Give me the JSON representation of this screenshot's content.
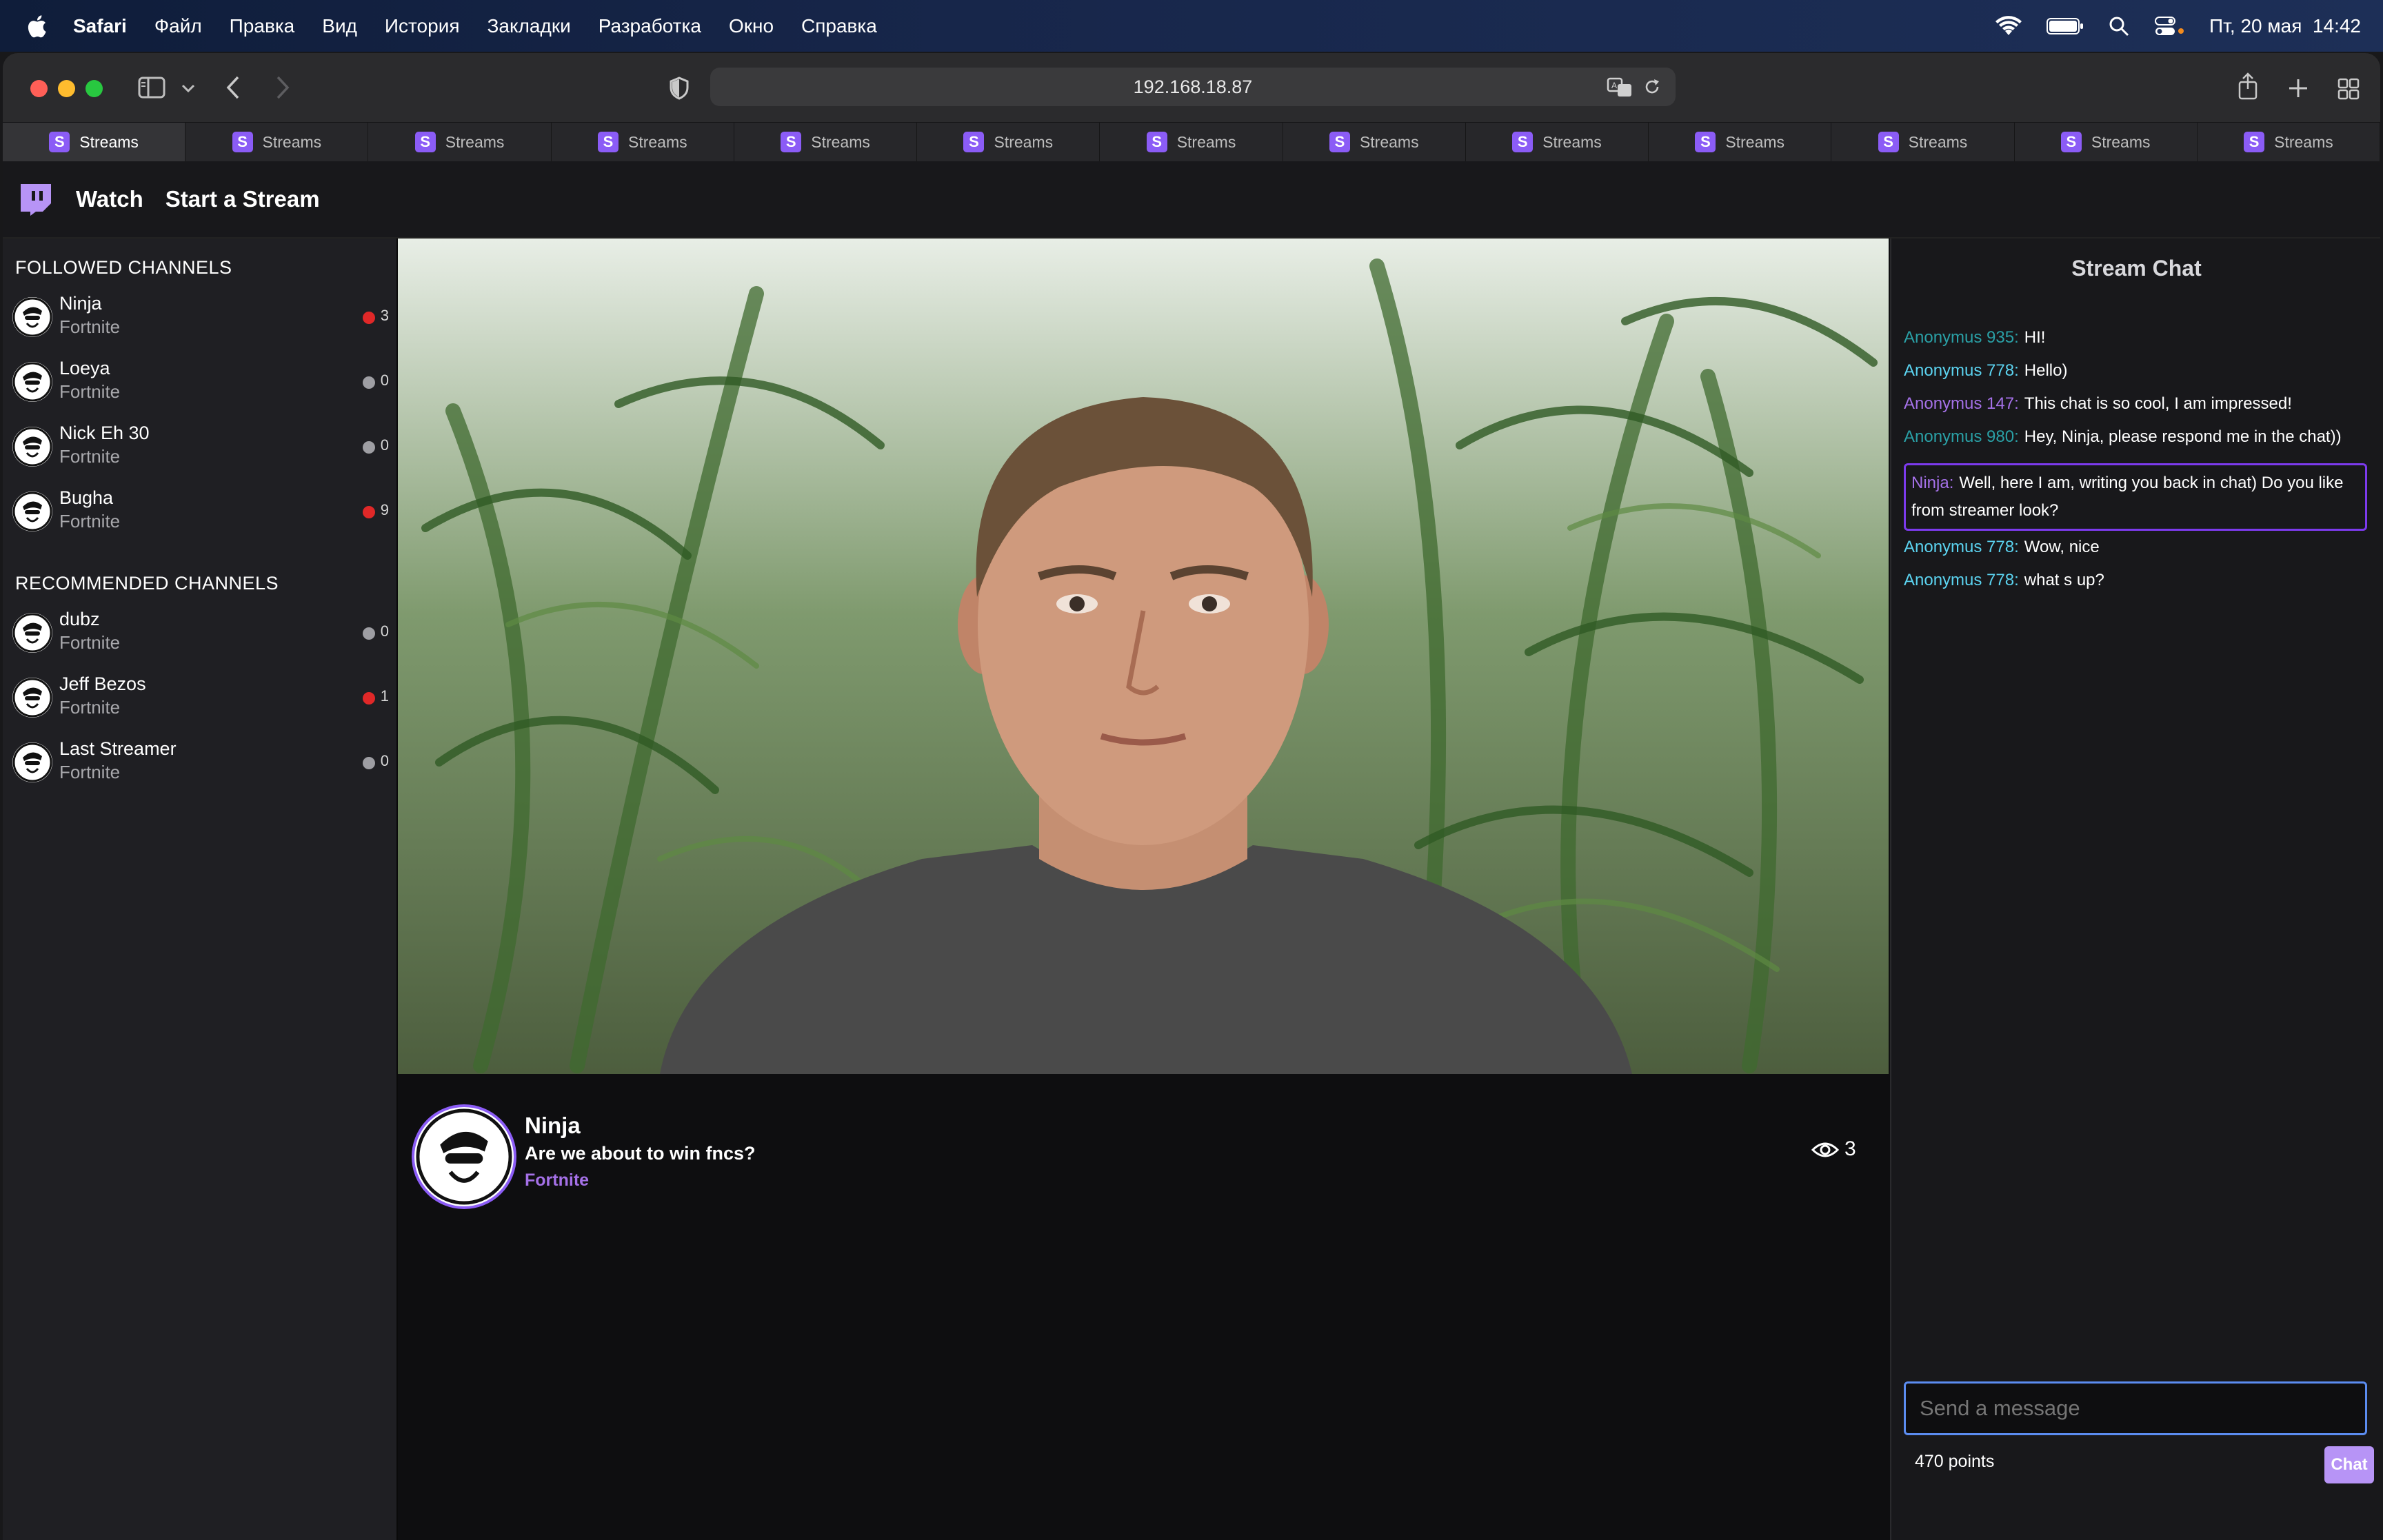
{
  "menubar": {
    "app": "Safari",
    "items": [
      "Файл",
      "Правка",
      "Вид",
      "История",
      "Закладки",
      "Разработка",
      "Окно",
      "Справка"
    ],
    "datetime": "Пт, 20 мая  14:42"
  },
  "browser": {
    "url": "192.168.18.87",
    "tabs": [
      "Streams",
      "Streams",
      "Streams",
      "Streams",
      "Streams",
      "Streams",
      "Streams",
      "Streams",
      "Streams",
      "Streams",
      "Streams",
      "Streams",
      "Streams"
    ],
    "favicon_letter": "S"
  },
  "nav": {
    "watch": "Watch",
    "start": "Start a Stream"
  },
  "sidebar": {
    "followed_title": "FOLLOWED CHANNELS",
    "followed": [
      {
        "name": "Ninja",
        "game": "Fortnite",
        "count": "3",
        "live": true
      },
      {
        "name": "Loeya",
        "game": "Fortnite",
        "count": "0",
        "live": false
      },
      {
        "name": "Nick Eh 30",
        "game": "Fortnite",
        "count": "0",
        "live": false
      },
      {
        "name": "Bugha",
        "game": "Fortnite",
        "count": "9",
        "live": true
      }
    ],
    "recommended_title": "RECOMMENDED CHANNELS",
    "recommended": [
      {
        "name": "dubz",
        "game": "Fortnite",
        "count": "0",
        "live": false
      },
      {
        "name": "Jeff Bezos",
        "game": "Fortnite",
        "count": "1",
        "live": true
      },
      {
        "name": "Last Streamer",
        "game": "Fortnite",
        "count": "0",
        "live": false
      }
    ]
  },
  "stream": {
    "streamer": "Ninja",
    "title": "Are we about to win fncs?",
    "game": "Fortnite",
    "viewers": "3"
  },
  "chat": {
    "title": "Stream Chat",
    "messages": [
      {
        "user": "Anonymus 935:",
        "text": "HI!",
        "color": "#2aa0a6"
      },
      {
        "user": "Anonymus 778:",
        "text": "Hello)",
        "color": "#5bd3f0"
      },
      {
        "user": "Anonymus 147:",
        "text": "This chat is so cool, I am impressed!",
        "color": "#a571e8"
      },
      {
        "user": "Anonymus 980:",
        "text": "Hey, Ninja, please respond me in the chat))",
        "color": "#2aa0a6"
      },
      {
        "user": "Ninja:",
        "text": "Well, here I am, writing you back in chat) Do you like from streamer look?",
        "color": "#a571e8",
        "highlight": true
      },
      {
        "user": "Anonymus 778:",
        "text": "Wow, nice",
        "color": "#5bd3f0"
      },
      {
        "user": "Anonymus 778:",
        "text": "what s up?",
        "color": "#5bd3f0"
      }
    ],
    "input_placeholder": "Send a message",
    "points": "470 points",
    "send_label": "Chat"
  },
  "colors": {
    "accent": "#8b5cf6",
    "live_red": "#e02828",
    "offline_gray": "#9e9ea3",
    "chat_highlight_border": "#7c3aed"
  }
}
